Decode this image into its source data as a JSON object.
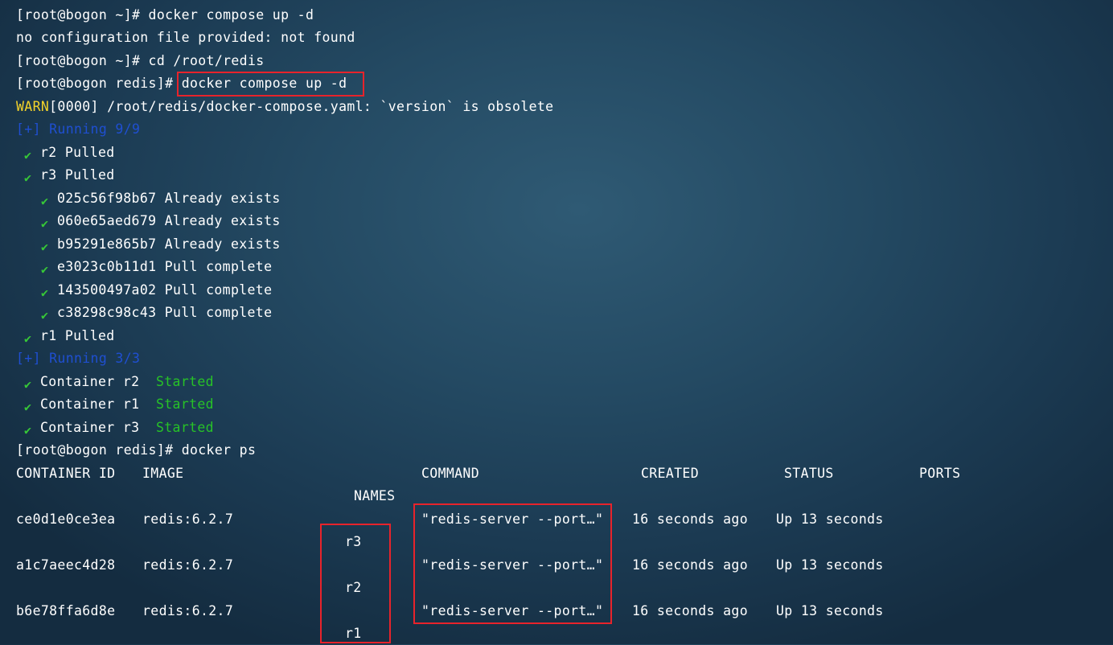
{
  "terminal": {
    "lines": [
      {
        "prompt": "[root@bogon ~]# ",
        "cmd": "docker compose up -d"
      },
      {
        "text": "no configuration file provided: not found"
      },
      {
        "prompt": "[root@bogon ~]# ",
        "cmd": "cd /root/redis"
      },
      {
        "prompt": "[root@bogon redis]# ",
        "cmd": "docker compose up -d"
      },
      {
        "warn": "WARN",
        "text": "[0000] /root/redis/docker-compose.yaml: `version` is obsolete"
      },
      {
        "text": "[+] Running 9/9"
      },
      {
        "text": "r2 Pulled"
      },
      {
        "text": "r3 Pulled"
      },
      {
        "text": "025c56f98b67 Already exists"
      },
      {
        "text": "060e65aed679 Already exists"
      },
      {
        "text": "b95291e865b7 Already exists"
      },
      {
        "text": "e3023c0b11d1 Pull complete"
      },
      {
        "text": "143500497a02 Pull complete"
      },
      {
        "text": "c38298c98c43 Pull complete"
      },
      {
        "text": "r1 Pulled"
      },
      {
        "text": "[+] Running 3/3"
      },
      {
        "text": "Container r2",
        "status": "Started"
      },
      {
        "text": "Container r1",
        "status": "Started"
      },
      {
        "text": "Container r3",
        "status": "Started"
      },
      {
        "prompt": "[root@bogon redis]# ",
        "cmd": "docker ps"
      }
    ],
    "check_glyph": "✔",
    "colors": {
      "warn": "#f2d22a",
      "running": "#1f4fd1",
      "started": "#27c227",
      "check": "#37c837",
      "highlight": "#e8232b"
    }
  },
  "ps_table": {
    "headers": {
      "container_id": "CONTAINER ID",
      "image": "IMAGE",
      "command": "COMMAND",
      "created": "CREATED",
      "status": "STATUS",
      "ports": "PORTS",
      "names": "NAMES"
    },
    "rows": [
      {
        "container_id": "ce0d1e0ce3ea",
        "image": "redis:6.2.7",
        "command": "\"redis-server --port…\"",
        "created": "16 seconds ago",
        "status": "Up 13 seconds",
        "name": "r3"
      },
      {
        "container_id": "a1c7aeec4d28",
        "image": "redis:6.2.7",
        "command": "\"redis-server --port…\"",
        "created": "16 seconds ago",
        "status": "Up 13 seconds",
        "name": "r2"
      },
      {
        "container_id": "b6e78ffa6d8e",
        "image": "redis:6.2.7",
        "command": "\"redis-server --port…\"",
        "created": "16 seconds ago",
        "status": "Up 13 seconds",
        "name": "r1"
      }
    ]
  }
}
